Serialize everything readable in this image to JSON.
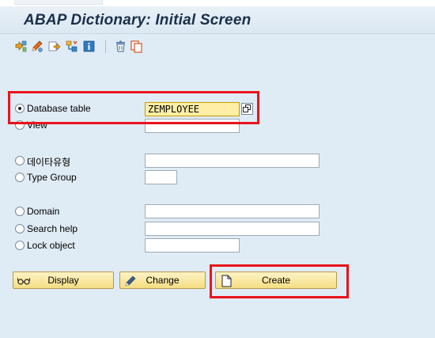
{
  "title": "ABAP Dictionary: Initial Screen",
  "toolbar": {
    "icons": [
      "other-object-icon",
      "where-used-icon",
      "check-icon",
      "activate-icon",
      "info-icon",
      "delete-icon",
      "copy-icon"
    ]
  },
  "objects": {
    "database_table": {
      "label": "Database table",
      "value": "ZEMPLOYEE",
      "selected": true
    },
    "view": {
      "label": "View",
      "value": ""
    },
    "data_type": {
      "label": "데이타유형",
      "value": ""
    },
    "type_group": {
      "label": "Type Group",
      "value": ""
    },
    "domain": {
      "label": "Domain",
      "value": ""
    },
    "search_help": {
      "label": "Search help",
      "value": ""
    },
    "lock_object": {
      "label": "Lock object",
      "value": ""
    }
  },
  "buttons": {
    "display": "Display",
    "change": "Change",
    "create": "Create"
  },
  "colors": {
    "background": "#dfebf5",
    "highlight_field": "#ffefa6",
    "button": "#f4dd82",
    "annotation": "#e8141a"
  }
}
